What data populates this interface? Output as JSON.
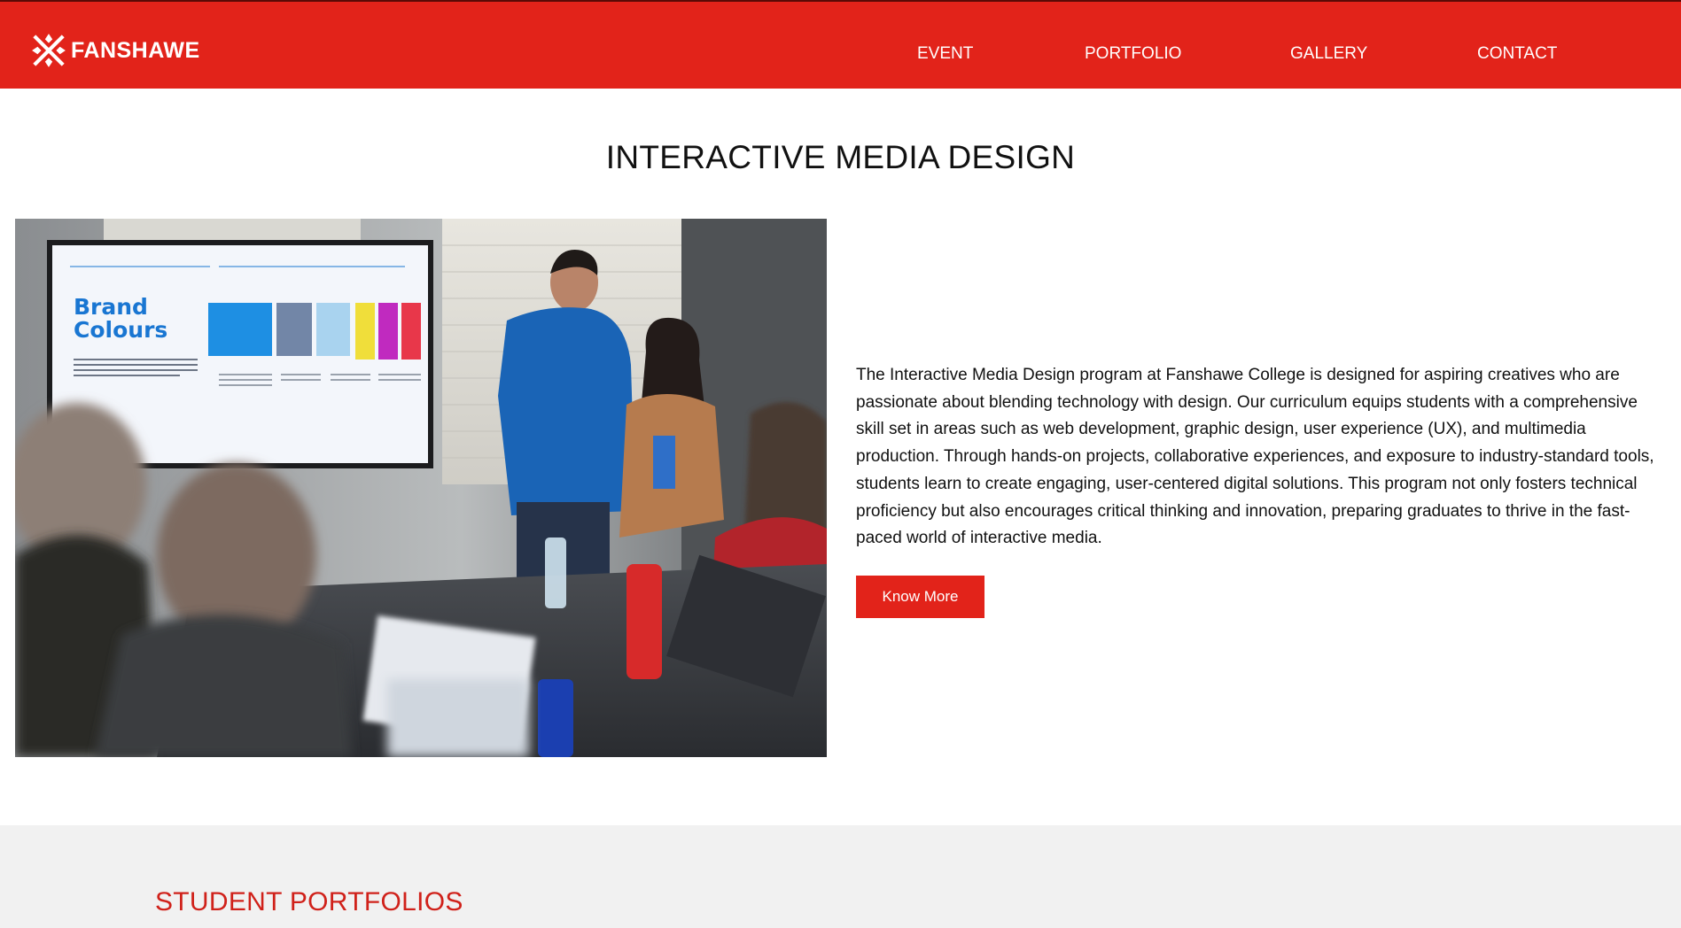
{
  "header": {
    "brand": "FANSHAWE",
    "nav": [
      "EVENT",
      "PORTFOLIO",
      "GALLERY",
      "CONTACT"
    ]
  },
  "main": {
    "title": "INTERACTIVE MEDIA DESIGN",
    "description": "The Interactive Media Design program at Fanshawe College is designed for aspiring creatives who are passionate about blending technology with design. Our curriculum equips students with a comprehensive skill set in areas such as web development, graphic design, user experience (UX), and multimedia production. Through hands-on projects, collaborative experiences, and exposure to industry-standard tools, students learn to create engaging, user-centered digital solutions. This program not only fosters technical proficiency but also encourages critical thinking and innovation, preparing graduates to thrive in the fast-paced world of interactive media.",
    "cta_label": "Know More",
    "photo": {
      "screen_heading_line1": "Brand",
      "screen_heading_line2": "Colours"
    }
  },
  "portfolios": {
    "title": "STUDENT PORTFOLIOS"
  },
  "colors": {
    "brand_red": "#e2231a",
    "band_gray": "#f1f1f1",
    "text": "#111111"
  }
}
